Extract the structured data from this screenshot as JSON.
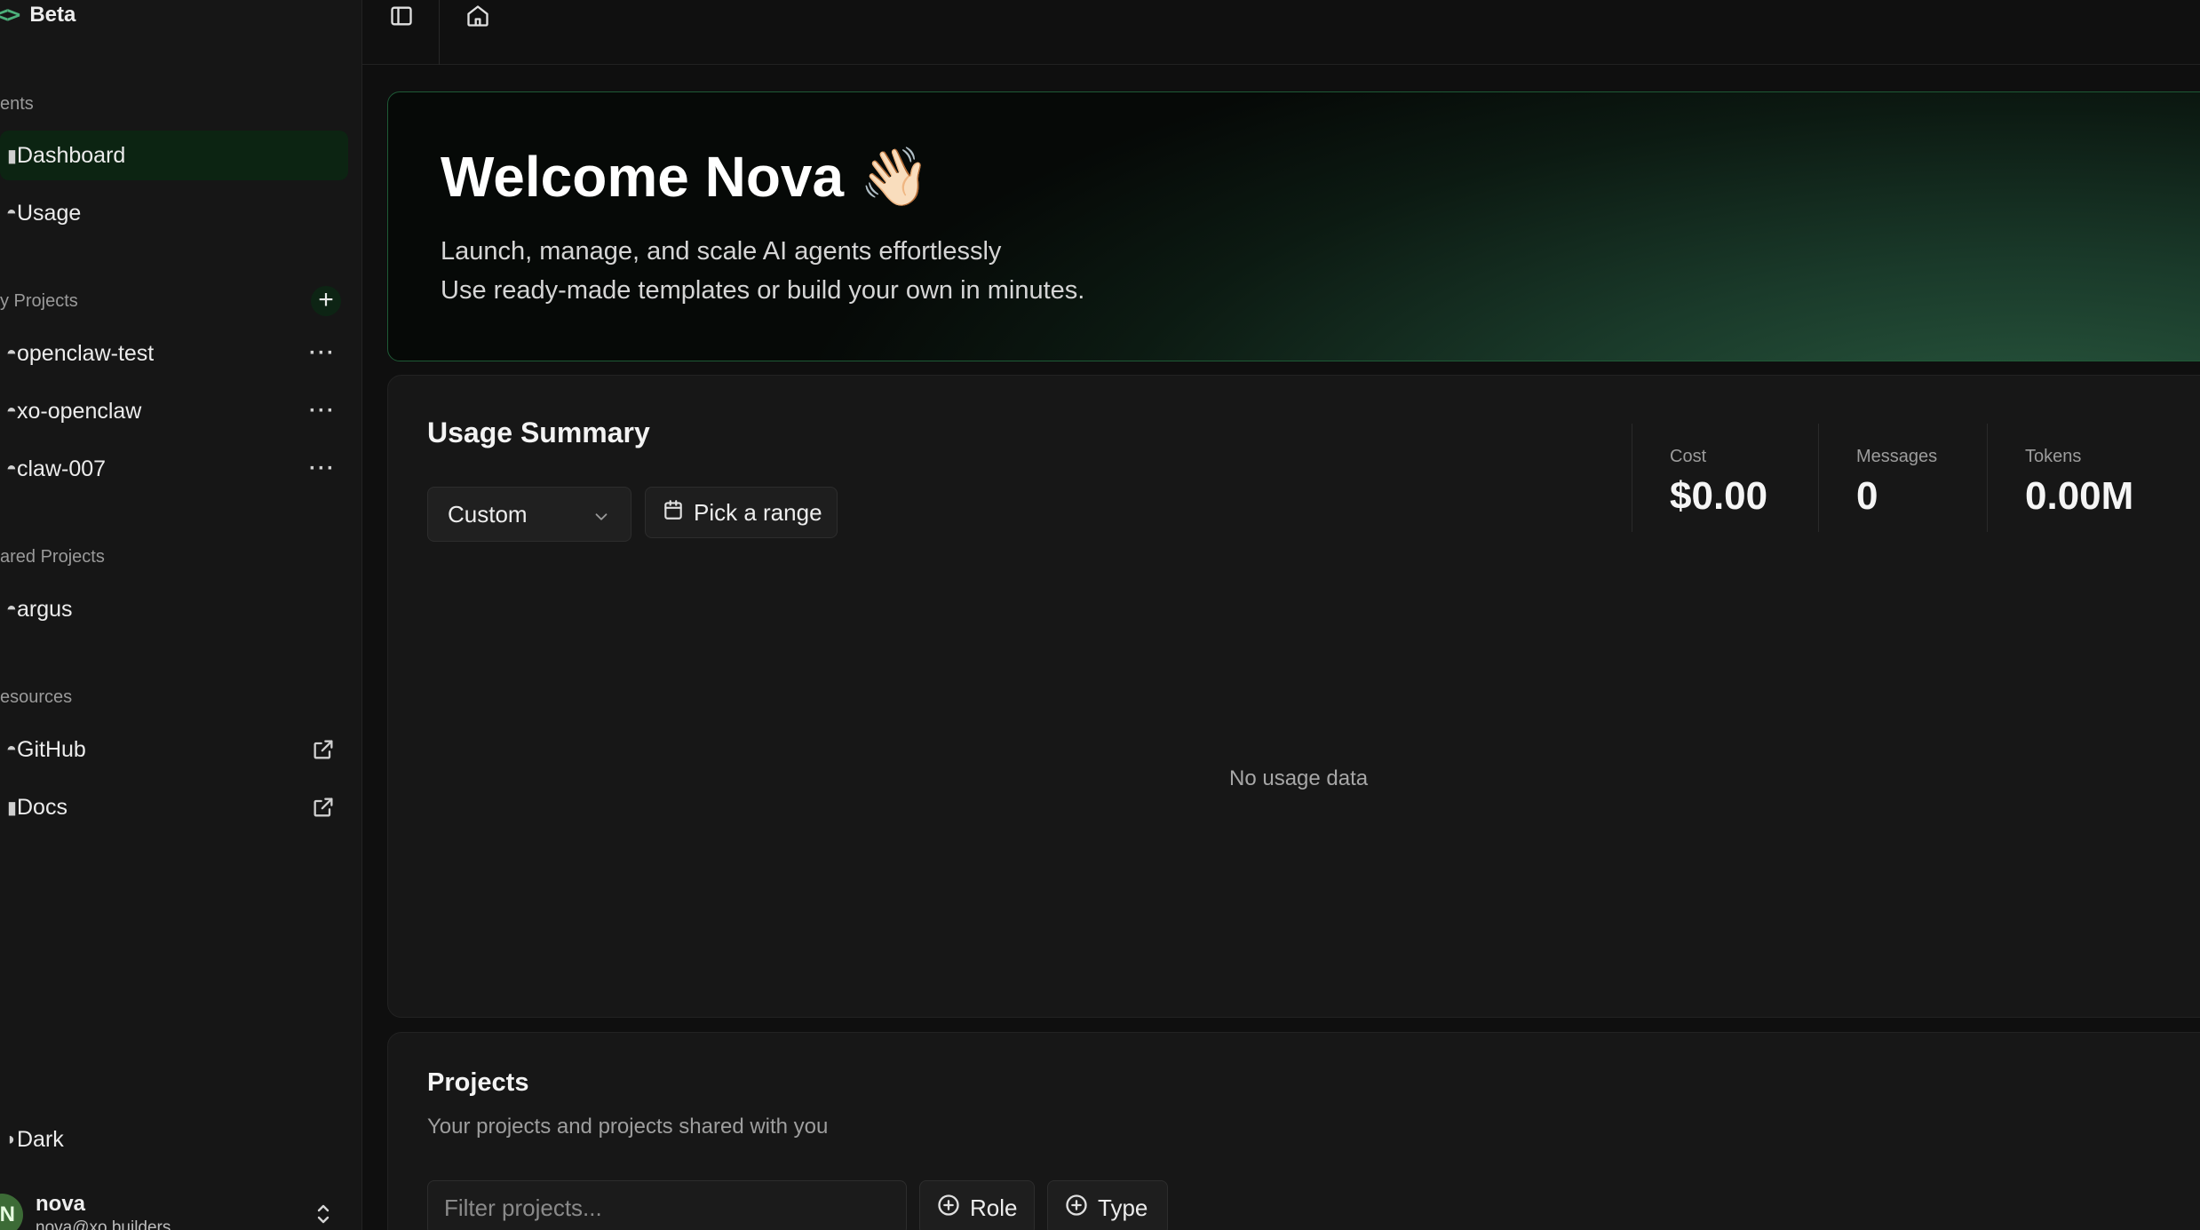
{
  "sidebar": {
    "brand": "Beta",
    "sections": {
      "agents": "ents",
      "my_projects": "y Projects",
      "shared_projects": "ared Projects",
      "resources": "esources"
    },
    "nav": {
      "dashboard": "Dashboard",
      "usage": "Usage"
    },
    "my_projects": [
      {
        "label": "openclaw-test"
      },
      {
        "label": "xo-openclaw"
      },
      {
        "label": "claw-007"
      }
    ],
    "shared_projects": [
      {
        "label": "argus"
      }
    ],
    "resources": [
      {
        "label": "GitHub"
      },
      {
        "label": "Docs"
      }
    ],
    "theme_label": "Dark",
    "user": {
      "initial": "N",
      "name": "nova",
      "email": "nova@xo.builders"
    }
  },
  "hero": {
    "title": "Welcome Nova 👋🏻",
    "line1": "Launch, manage, and scale AI agents effortlessly",
    "line2": "Use ready-made templates or build your own in minutes."
  },
  "usage": {
    "title": "Usage Summary",
    "range_select": "Custom",
    "pick_range": "Pick a range",
    "metrics": {
      "cost_label": "Cost",
      "cost_value": "$0.00",
      "messages_label": "Messages",
      "messages_value": "0",
      "tokens_label": "Tokens",
      "tokens_value": "0.00M"
    },
    "empty": "No usage data"
  },
  "projects": {
    "title": "Projects",
    "subtitle": "Your projects and projects shared with you",
    "filter_placeholder": "Filter projects...",
    "role_label": "Role",
    "type_label": "Type"
  },
  "colors": {
    "accent": "#4caf7a",
    "active_bg": "#0c2412",
    "hero_border": "#1e5a36"
  }
}
